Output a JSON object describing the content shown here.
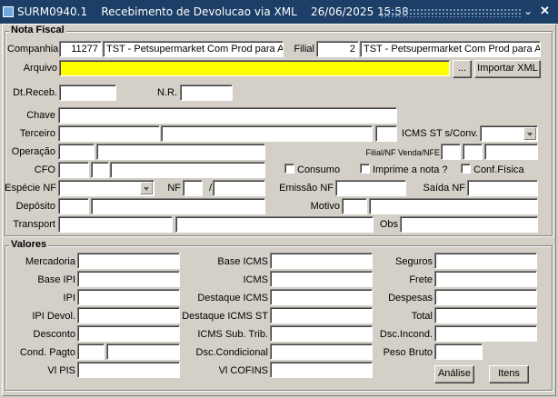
{
  "window": {
    "title": "SURM0940.1    Recebimento de Devolucao via XML    26/06/2025 15:58",
    "minimize_glyph": "⌄",
    "close_glyph": "✕"
  },
  "nota_fiscal": {
    "group_title": "Nota Fiscal",
    "companhia_label": "Companhia",
    "companhia_code": "11277",
    "companhia_name": "TST - Petsupermarket Com Prod para An",
    "filial_label": "Filial",
    "filial_code": "2",
    "filial_name": "TST - Petsupermarket Com Prod para An",
    "arquivo_label": "Arquivo",
    "arquivo_value": "",
    "browse_label": "...",
    "importar_label": "Importar XML",
    "dt_receb_label": "Dt.Receb.",
    "nr_label": "N.R.",
    "chave_label": "Chave",
    "terceiro_label": "Terceiro",
    "icms_st_label": "ICMS ST s/Conv.",
    "operacao_label": "Operação",
    "filial_nf_label": "Filial/NF Venda/NFE",
    "cfo_label": "CFO",
    "consumo_label": "Consumo",
    "imprime_label": "Imprime a nota ?",
    "conf_fisica_label": "Conf.Física",
    "especie_label": "Espécie NF",
    "nf_label": "NF",
    "slash": "/",
    "emissao_label": "Emissão NF",
    "saida_label": "Saída NF",
    "deposito_label": "Depósito",
    "motivo_label": "Motivo",
    "transport_label": "Transport",
    "obs_label": "Obs"
  },
  "valores": {
    "group_title": "Valores",
    "mercadoria_label": "Mercadoria",
    "base_ipi_label": "Base IPI",
    "ipi_label": "IPI",
    "ipi_devol_label": "IPI Devol.",
    "desconto_label": "Desconto",
    "cond_pagto_label": "Cond. Pagto",
    "vl_pis_label": "Vl PIS",
    "base_icms_label": "Base ICMS",
    "icms_label": "ICMS",
    "destaque_icms_label": "Destaque ICMS",
    "destaque_icms_st_label": "Destaque ICMS ST",
    "icms_sub_trib_label": "ICMS Sub. Trib.",
    "dsc_condicional_label": "Dsc.Condicional",
    "vl_cofins_label": "Vl COFINS",
    "seguros_label": "Seguros",
    "frete_label": "Frete",
    "despesas_label": "Despesas",
    "total_label": "Total",
    "dsc_incond_label": "Dsc.Incond.",
    "peso_bruto_label": "Peso Bruto",
    "analise_label": "Análise",
    "itens_label": "Itens"
  }
}
